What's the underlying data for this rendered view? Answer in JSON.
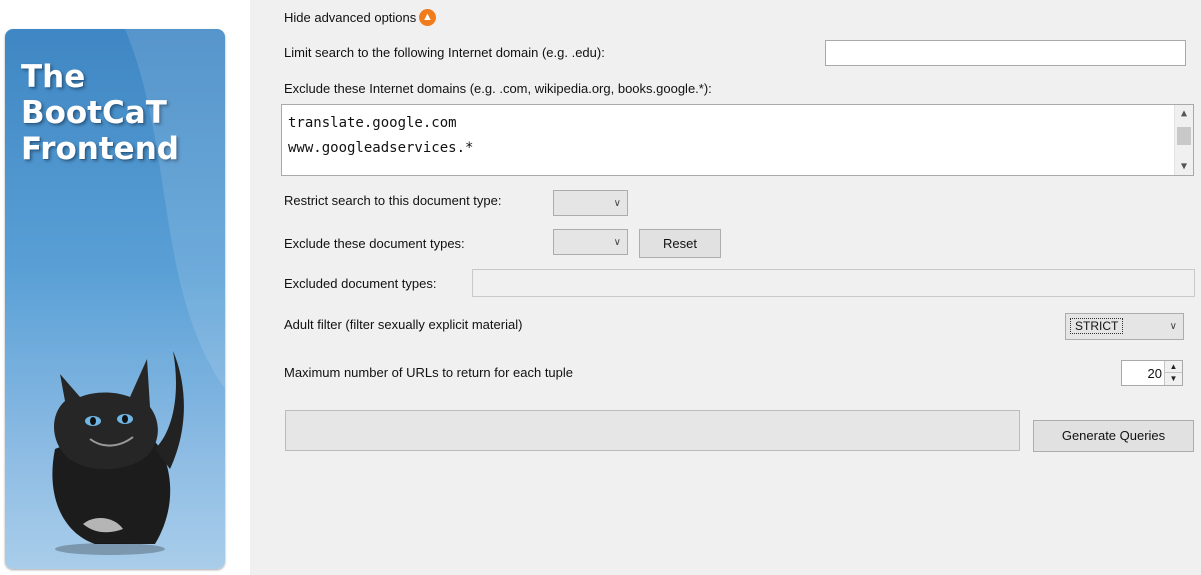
{
  "banner": {
    "title_lines": [
      "The",
      "BootCaT",
      "Frontend"
    ],
    "mascot_icon": "black-cat-icon"
  },
  "advanced": {
    "toggle_label": "Hide advanced options",
    "toggle_icon": "arrow-up-circle-icon",
    "toggle_icon_color": "#f07c1e"
  },
  "domain_limit": {
    "label": "Limit search to the following Internet domain (e.g. .edu):",
    "value": ""
  },
  "exclude_domains": {
    "label": "Exclude these Internet domains (e.g. .com, wikipedia.org, books.google.*):",
    "lines": [
      "translate.google.com",
      "www.googleadservices.*"
    ]
  },
  "restrict_doctype": {
    "label": "Restrict search to this document type:",
    "value": ""
  },
  "exclude_doctypes": {
    "label": "Exclude these document types:",
    "value": "",
    "reset_label": "Reset"
  },
  "excluded_doctypes": {
    "label": "Excluded document types:",
    "value": ""
  },
  "adult_filter": {
    "label": "Adult filter (filter sexually explicit material)",
    "value": "STRICT"
  },
  "max_urls": {
    "label": "Maximum number of URLs to return for each tuple",
    "value": "20"
  },
  "generate": {
    "button_label": "Generate Queries",
    "progress": 0
  }
}
